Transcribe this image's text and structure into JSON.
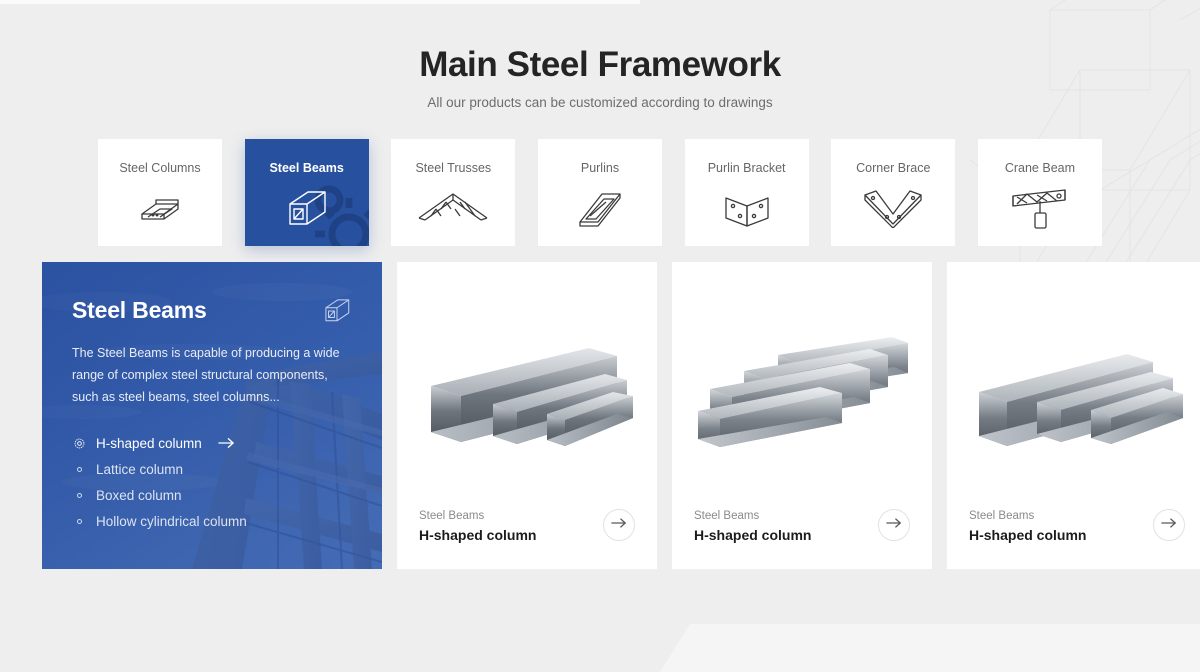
{
  "header": {
    "title": "Main Steel Framework",
    "subtitle": "All our products can be customized according to drawings"
  },
  "colors": {
    "page_background": "#eeeeee",
    "accent_blue": "#27519f",
    "card_background": "#ffffff",
    "title_text": "#242424",
    "muted_text": "#6d6d6d"
  },
  "tabs": [
    {
      "label": "Steel Columns",
      "icon": "i-beam-icon",
      "active": false
    },
    {
      "label": "Steel Beams",
      "icon": "box-beam-icon",
      "active": true
    },
    {
      "label": "Steel Trusses",
      "icon": "truss-icon",
      "active": false
    },
    {
      "label": "Purlins",
      "icon": "purlin-icon",
      "active": false
    },
    {
      "label": "Purlin Bracket",
      "icon": "bracket-icon",
      "active": false
    },
    {
      "label": "Corner Brace",
      "icon": "corner-brace-icon",
      "active": false
    },
    {
      "label": "Crane Beam",
      "icon": "crane-beam-icon",
      "active": false
    }
  ],
  "feature_panel": {
    "title": "Steel Beams",
    "corner_icon": "box-beam-icon",
    "description": "The Steel Beams is capable of producing a wide range of complex steel structural components, such as steel beams, steel columns...",
    "items": [
      {
        "label": "H-shaped column",
        "active": true,
        "icon": "gear-icon",
        "arrow": "arrow-right-icon"
      },
      {
        "label": "Lattice column",
        "active": false,
        "icon": "bullet-icon"
      },
      {
        "label": "Boxed column",
        "active": false,
        "icon": "bullet-icon"
      },
      {
        "label": "Hollow cylindrical column",
        "active": false,
        "icon": "bullet-icon"
      }
    ]
  },
  "products": [
    {
      "category": "Steel Beams",
      "name": "H-shaped column",
      "image": "steel-i-beams-photo",
      "arrow": "arrow-right-icon"
    },
    {
      "category": "Steel Beams",
      "name": "H-shaped column",
      "image": "steel-i-beams-photo",
      "arrow": "arrow-right-icon"
    },
    {
      "category": "Steel Beams",
      "name": "H-shaped column",
      "image": "steel-i-beams-photo",
      "arrow": "arrow-right-icon"
    }
  ]
}
